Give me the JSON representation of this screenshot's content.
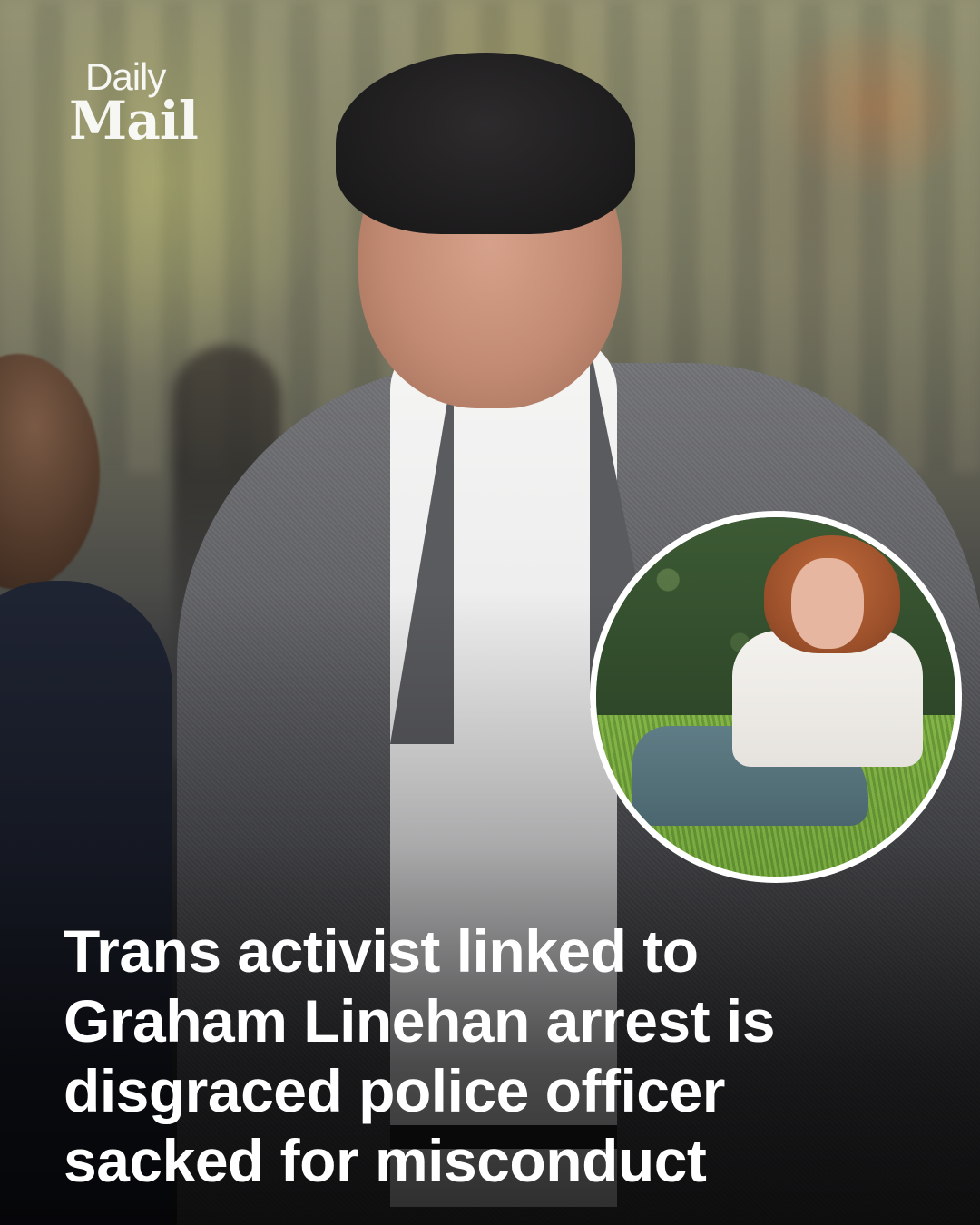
{
  "logo": {
    "line1": "Daily",
    "line2": "Mail"
  },
  "headline": {
    "lines": [
      "Trans activist linked to",
      "Graham Linehan arrest is",
      "disgraced police officer",
      "sacked for misconduct"
    ]
  },
  "colors": {
    "headline_text": "#ffffff",
    "inset_border": "#ffffff"
  }
}
